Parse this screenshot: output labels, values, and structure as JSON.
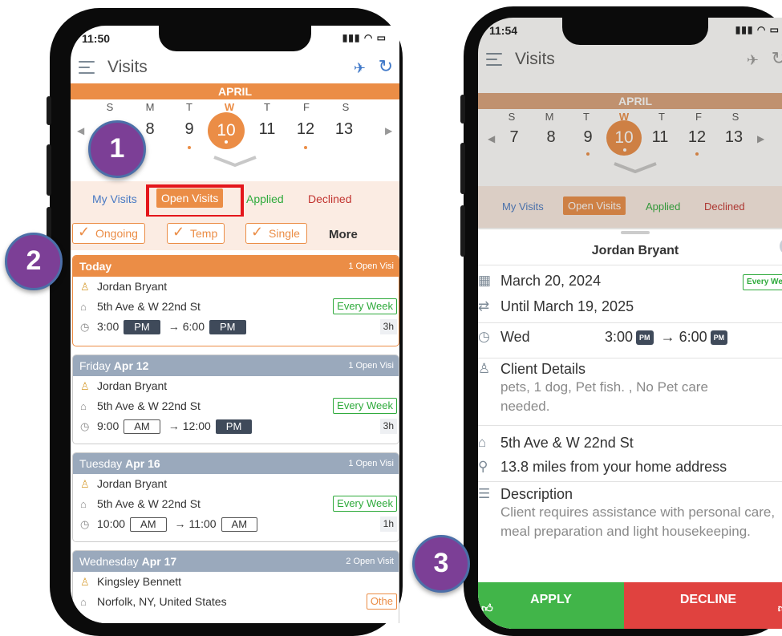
{
  "left_phone": {
    "status_time": "11:50",
    "header_title": "Visits",
    "month": "APRIL",
    "weekdays": [
      "S",
      "M",
      "T",
      "W",
      "T",
      "F",
      "S"
    ],
    "days": [
      "8",
      "9",
      "10",
      "11",
      "12",
      "13"
    ],
    "selected_day": "10",
    "tabs": [
      "My Visits",
      "Open Visits",
      "Applied",
      "Declined"
    ],
    "filters": [
      "Ongoing",
      "Temp",
      "Single"
    ],
    "more_label": "More",
    "cards": [
      {
        "day_label": "Today",
        "day_bold": "",
        "count": "1 Open Visi",
        "client": "Jordan Bryant",
        "address": "5th Ave & W 22nd St",
        "tag": "Every Week",
        "start": "3:00",
        "start_ampm": "PM",
        "end": "6:00",
        "end_ampm": "PM",
        "duration": "3h"
      },
      {
        "day_label": "Friday",
        "day_bold": "Apr 12",
        "count": "1 Open Visi",
        "client": "Jordan Bryant",
        "address": "5th Ave & W 22nd St",
        "tag": "Every Week",
        "start": "9:00",
        "start_ampm": "AM",
        "end": "12:00",
        "end_ampm": "PM",
        "duration": "3h"
      },
      {
        "day_label": "Tuesday",
        "day_bold": "Apr 16",
        "count": "1 Open Visi",
        "client": "Jordan Bryant",
        "address": "5th Ave & W 22nd St",
        "tag": "Every Week",
        "start": "10:00",
        "start_ampm": "AM",
        "end": "11:00",
        "end_ampm": "AM",
        "duration": "1h"
      },
      {
        "day_label": "Wednesday",
        "day_bold": "Apr 17",
        "count": "2 Open Visit",
        "client": "Kingsley Bennett",
        "address": "Norfolk, NY, United States",
        "tag": "Othe"
      }
    ]
  },
  "right_phone": {
    "status_time": "11:54",
    "header_title": "Visits",
    "month": "APRIL",
    "weekdays": [
      "S",
      "M",
      "T",
      "W",
      "T",
      "F",
      "S"
    ],
    "days": [
      "7",
      "8",
      "9",
      "10",
      "11",
      "12",
      "13"
    ],
    "selected_day": "10",
    "tabs": [
      "My Visits",
      "Open Visits",
      "Applied",
      "Declined"
    ],
    "sheet": {
      "client_name": "Jordan Bryant",
      "start_date": "March 20, 2024",
      "recurrence": "Every Week",
      "until": "Until March 19, 2025",
      "weekday": "Wed",
      "start_time": "3:00",
      "start_ampm": "PM",
      "end_time": "6:00",
      "end_ampm": "PM",
      "client_details_label": "Client Details",
      "client_details": "pets, 1 dog, Pet fish. , No Pet care needed.",
      "address": "5th Ave & W 22nd St",
      "distance": "13.8 miles from your home address",
      "description_label": "Description",
      "description": "Client requires assistance with personal care, meal preparation and light housekeeping.",
      "apply_label": "APPLY",
      "decline_label": "DECLINE"
    }
  },
  "badges": [
    "1",
    "2",
    "3"
  ],
  "colors": {
    "accent_orange": "#eb8d46",
    "applied_green": "#2eaa3b",
    "declined_red": "#c2332f",
    "link_blue": "#4879c3",
    "badge_purple": "#7c3f96",
    "highlight_red": "#e4161b"
  }
}
